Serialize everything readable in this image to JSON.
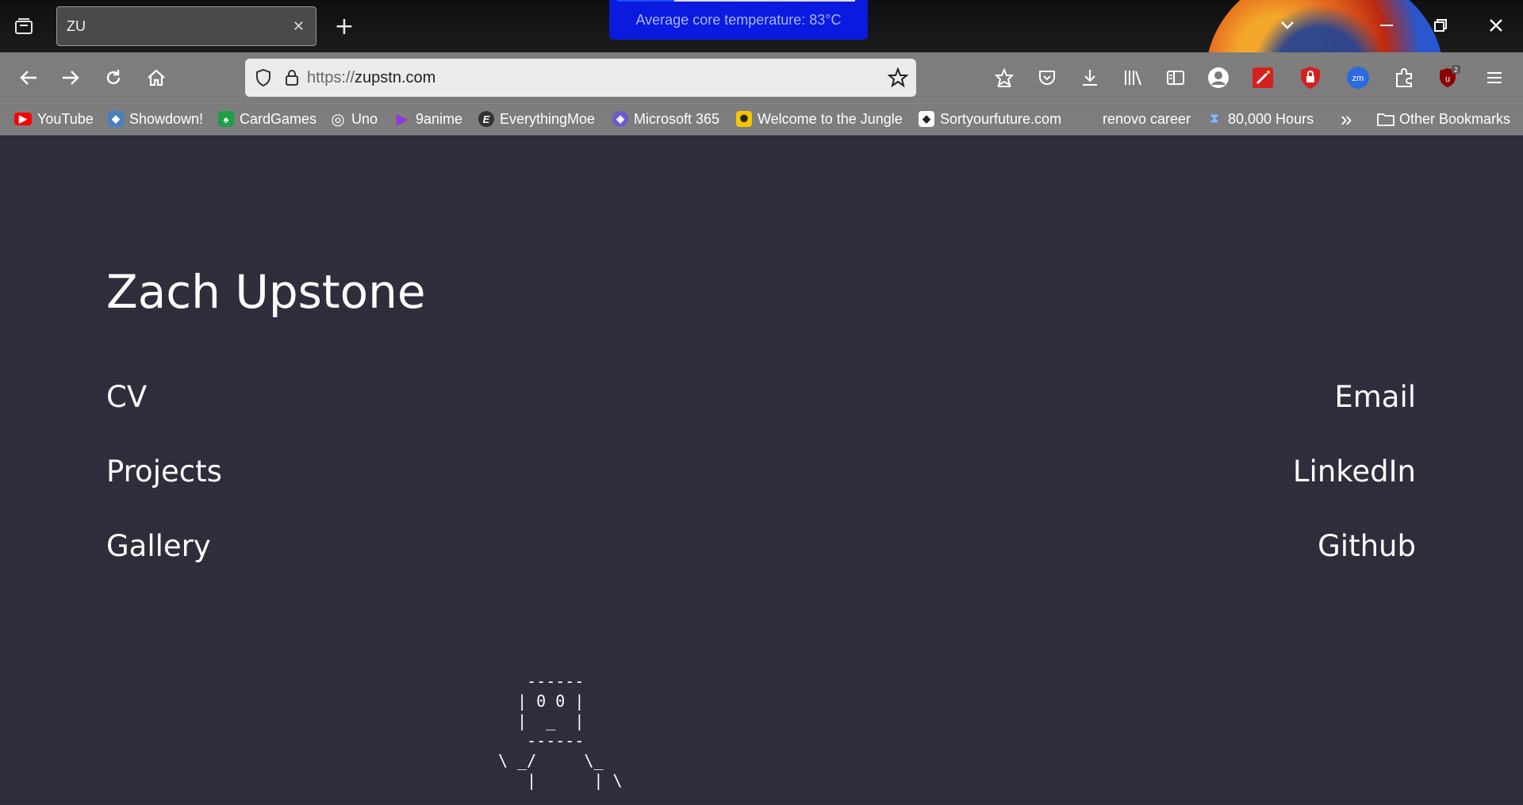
{
  "browser": {
    "tab": {
      "title": "ZU",
      "close_symbol": "✕"
    },
    "new_tab_symbol": "+",
    "overlay": {
      "text": "Average core temperature:  83°C"
    },
    "url": {
      "protocol": "https://",
      "host": "zupstn.com"
    },
    "extensions": [
      {
        "name": "profile-icon"
      },
      {
        "name": "magic-wand-icon",
        "color": "#d61f1f"
      },
      {
        "name": "lock-shield-icon",
        "color": "#d61f1f"
      },
      {
        "name": "zoom-icon",
        "label": "zm",
        "color": "#2d6ae0"
      },
      {
        "name": "puzzle-icon"
      },
      {
        "name": "ublock-icon",
        "badge": "2",
        "color": "#8c0000"
      }
    ],
    "bookmarks": [
      {
        "label": "YouTube",
        "icon": "youtube-icon",
        "color": "#ff0000",
        "glyph": "▶"
      },
      {
        "label": "Showdown!",
        "icon": "pokemon-showdown-icon",
        "color": "#4a7fbd",
        "glyph": "◆"
      },
      {
        "label": "CardGames",
        "icon": "card-icon",
        "color": "#1e9e45",
        "glyph": "♠"
      },
      {
        "label": "Uno",
        "icon": "globe-icon",
        "color": "transparent",
        "glyph": "◎"
      },
      {
        "label": "9anime",
        "icon": "play-icon",
        "color": "transparent",
        "glyph": "▶"
      },
      {
        "label": "EverythingMoe",
        "icon": "e-logo-icon",
        "color": "#333333",
        "glyph": "E"
      },
      {
        "label": "Microsoft 365",
        "icon": "microsoft-365-icon",
        "color": "#6a5ad3",
        "glyph": "◈"
      },
      {
        "label": "Welcome to the Jungle",
        "icon": "jungle-icon",
        "color": "#f6c600",
        "glyph": "✺"
      },
      {
        "label": "Sortyourfuture.com",
        "icon": "sort-icon",
        "color": "#ffffff",
        "glyph": "◆"
      },
      {
        "label": "renovo career",
        "icon": "none",
        "color": "transparent",
        "glyph": ""
      },
      {
        "label": "80,000 Hours",
        "icon": "hourglass-icon",
        "color": "transparent",
        "glyph": "⧗"
      }
    ],
    "overflow_symbol": "»",
    "other_bookmarks": "Other Bookmarks"
  },
  "page": {
    "title": "Zach Upstone",
    "left_links": [
      "CV",
      "Projects",
      "Gallery"
    ],
    "right_links": [
      "Email",
      "LinkedIn",
      "Github"
    ],
    "ascii_art": "   ------\n  | 0 0 |\n  |  _  |\n   ------\n\\ _/     \\_\n   |      | \\"
  }
}
